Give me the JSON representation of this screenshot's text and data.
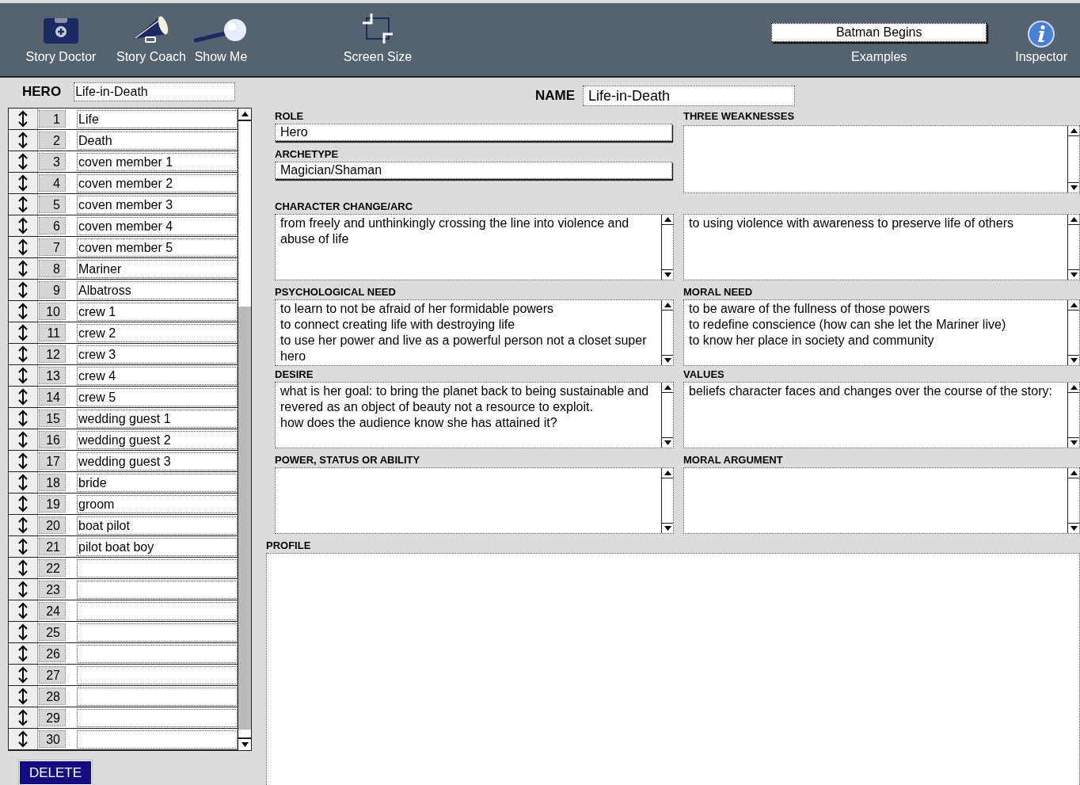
{
  "toolbar": {
    "tools": [
      {
        "kind": "doctor",
        "label": "Story Doctor"
      },
      {
        "kind": "coach",
        "label": "Story Coach"
      },
      {
        "kind": "show",
        "label": "Show Me"
      },
      {
        "kind": "screen",
        "label": "Screen Size"
      }
    ],
    "examples": {
      "value": "Batman Begins",
      "label": "Examples"
    },
    "inspector": {
      "label": "Inspector"
    }
  },
  "hero": {
    "label": "HERO",
    "value": "Life-in-Death"
  },
  "characters": [
    {
      "number": "1",
      "name": "Life"
    },
    {
      "number": "2",
      "name": "Death"
    },
    {
      "number": "3",
      "name": "coven member 1"
    },
    {
      "number": "4",
      "name": "coven member 2"
    },
    {
      "number": "5",
      "name": "coven member 3"
    },
    {
      "number": "6",
      "name": "coven member 4"
    },
    {
      "number": "7",
      "name": "coven member 5"
    },
    {
      "number": "8",
      "name": "Mariner"
    },
    {
      "number": "9",
      "name": "Albatross"
    },
    {
      "number": "10",
      "name": "crew 1"
    },
    {
      "number": "11",
      "name": "crew 2"
    },
    {
      "number": "12",
      "name": "crew 3"
    },
    {
      "number": "13",
      "name": "crew 4"
    },
    {
      "number": "14",
      "name": "crew 5"
    },
    {
      "number": "15",
      "name": "wedding guest 1"
    },
    {
      "number": "16",
      "name": "wedding guest 2"
    },
    {
      "number": "17",
      "name": "wedding guest 3"
    },
    {
      "number": "18",
      "name": "bride"
    },
    {
      "number": "19",
      "name": "groom"
    },
    {
      "number": "20",
      "name": "boat pilot"
    },
    {
      "number": "21",
      "name": "pilot boat boy"
    },
    {
      "number": "22"
    },
    {
      "number": "23"
    },
    {
      "number": "24"
    },
    {
      "number": "25"
    },
    {
      "number": "26"
    },
    {
      "number": "27"
    },
    {
      "number": "28"
    },
    {
      "number": "29"
    },
    {
      "number": "30"
    }
  ],
  "delete_button": "DELETE",
  "name": {
    "label": "NAME",
    "value": "Life-in-Death"
  },
  "sections": [
    {
      "cells": [
        {
          "fields": [
            {
              "kind": "line",
              "label": "ROLE",
              "value": "Hero"
            },
            {
              "kind": "line",
              "label": "ARCHETYPE",
              "value": "Magician/Shaman"
            }
          ]
        },
        {
          "fields": [
            {
              "kind": "tall",
              "label": "THREE WEAKNESSES"
            }
          ]
        }
      ]
    },
    {
      "cells": [
        {
          "fields": [
            {
              "kind": "text",
              "label": "CHARACTER CHANGE/ARC",
              "value": "from freely and unthinkingly crossing the line into violence and abuse of life"
            }
          ]
        },
        {
          "fields": [
            {
              "kind": "text",
              "value": "to using violence with awareness to preserve life of others"
            }
          ]
        }
      ]
    },
    {
      "cells": [
        {
          "fields": [
            {
              "kind": "text",
              "label": "PSYCHOLOGICAL NEED",
              "value": "to learn to not be afraid of her formidable powers\nto connect creating life with destroying life\nto use her power and live as a powerful person not a closet super hero"
            }
          ]
        },
        {
          "fields": [
            {
              "kind": "text",
              "label": "MORAL NEED",
              "value": "to be aware of the fullness of those powers\nto redefine conscience (how can she let the Mariner live)\nto know her place in society and community"
            }
          ]
        }
      ]
    },
    {
      "cells": [
        {
          "fields": [
            {
              "kind": "text",
              "label": "DESIRE",
              "value": "what is her goal: to bring the planet back to being sustainable and revered as an object of beauty not a resource to exploit.\nhow does the audience know she has attained it?"
            }
          ]
        },
        {
          "fields": [
            {
              "kind": "text",
              "label": "VALUES",
              "value": "beliefs character faces and changes over the course of the story:"
            }
          ]
        }
      ]
    },
    {
      "cells": [
        {
          "fields": [
            {
              "kind": "text",
              "label": "POWER, STATUS OR ABILITY"
            }
          ]
        },
        {
          "fields": [
            {
              "kind": "text",
              "label": "MORAL ARGUMENT"
            }
          ]
        }
      ]
    }
  ],
  "profile": {
    "label": "PROFILE"
  }
}
